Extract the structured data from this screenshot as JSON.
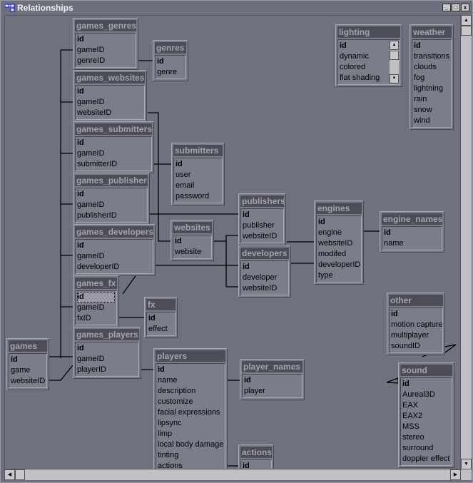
{
  "window": {
    "title": "Relationships",
    "buttons": [
      "_",
      "□",
      "x"
    ]
  },
  "tables": [
    {
      "name": "games_genres",
      "fields": [
        "id",
        "gameID",
        "genreID"
      ]
    },
    {
      "name": "genres",
      "fields": [
        "id",
        "genre"
      ]
    },
    {
      "name": "games_websites",
      "fields": [
        "id",
        "gameID",
        "websiteID"
      ]
    },
    {
      "name": "games_submitters",
      "fields": [
        "id",
        "gameID",
        "submitterID"
      ]
    },
    {
      "name": "submitters",
      "fields": [
        "id",
        "user",
        "email",
        "password"
      ]
    },
    {
      "name": "games_publishers",
      "fields": [
        "id",
        "gameID",
        "publisherID"
      ]
    },
    {
      "name": "games_developers",
      "fields": [
        "id",
        "gameID",
        "developerID"
      ]
    },
    {
      "name": "publishers",
      "fields": [
        "id",
        "publisher",
        "websiteID"
      ]
    },
    {
      "name": "websites",
      "fields": [
        "id",
        "website"
      ]
    },
    {
      "name": "developers",
      "fields": [
        "id",
        "developer",
        "websiteID"
      ]
    },
    {
      "name": "engines",
      "fields": [
        "id",
        "engine",
        "websiteID",
        "modifed",
        "developerID",
        "type"
      ]
    },
    {
      "name": "engine_names",
      "fields": [
        "id",
        "name"
      ]
    },
    {
      "name": "games_fx",
      "fields": [
        "id",
        "gameID",
        "fxID"
      ],
      "selected_field": "id"
    },
    {
      "name": "fx",
      "fields": [
        "id",
        "effect"
      ]
    },
    {
      "name": "games",
      "fields": [
        "id",
        "game",
        "websiteID"
      ]
    },
    {
      "name": "games_players",
      "fields": [
        "id",
        "gameID",
        "playerID"
      ]
    },
    {
      "name": "players",
      "fields": [
        "id",
        "name",
        "description",
        "customize",
        "facial expressions",
        "lipsync",
        "limp",
        "local body damage",
        "tinting",
        "actions"
      ]
    },
    {
      "name": "player_names",
      "fields": [
        "id",
        "player"
      ]
    },
    {
      "name": "actions",
      "fields": [
        "id"
      ]
    },
    {
      "name": "lighting",
      "fields": [
        "id",
        "dynamic",
        "colored",
        "flat shading"
      ],
      "has_scrollbar": true
    },
    {
      "name": "weather",
      "fields": [
        "id",
        "transitions",
        "clouds",
        "fog",
        "lightning",
        "rain",
        "snow",
        "wind"
      ]
    },
    {
      "name": "other",
      "fields": [
        "id",
        "motion capture",
        "multiplayer",
        "soundID"
      ]
    },
    {
      "name": "sound",
      "fields": [
        "id",
        "Aureal3D",
        "EAX",
        "EAX2",
        "MSS",
        "stereo",
        "surround",
        "doppler effect"
      ]
    }
  ]
}
